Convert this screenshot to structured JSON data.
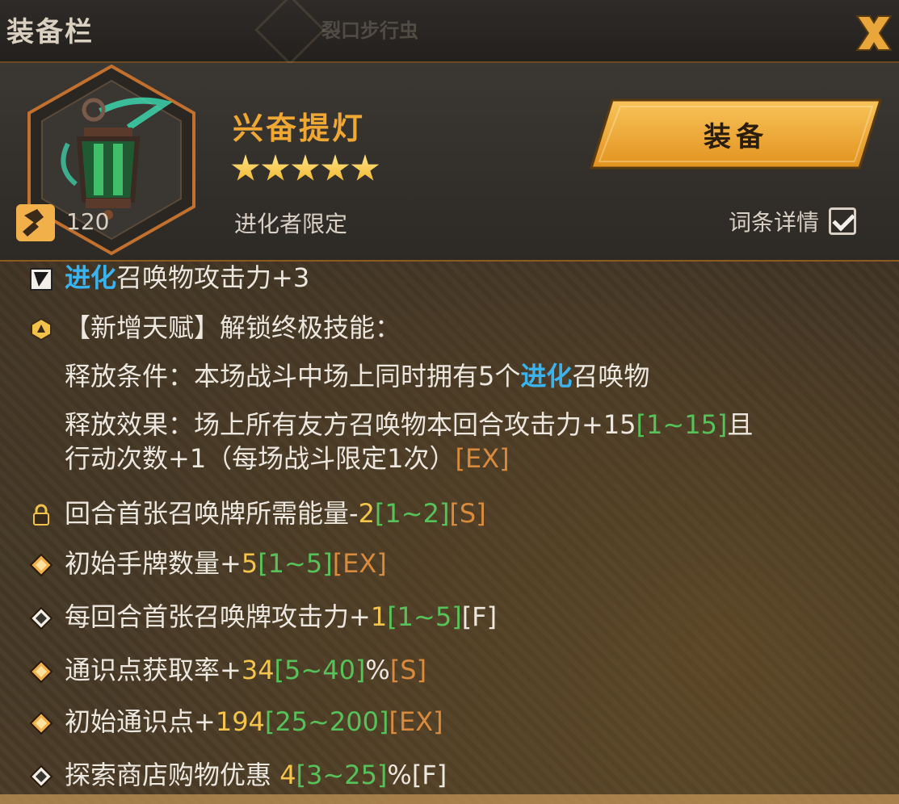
{
  "window": {
    "title": "装备栏",
    "background_label": "裂口步行虫"
  },
  "item": {
    "name": "兴奋提灯",
    "stars": 5,
    "restriction": "进化者限定",
    "level": "120",
    "icon": "green-lantern-icon"
  },
  "actions": {
    "equip_label": "装备",
    "detail_label": "词条详情",
    "detail_checked": true
  },
  "stats": [
    {
      "icon": "evolve-tag-icon",
      "parts": [
        {
          "t": "进化",
          "c": "blue"
        },
        {
          "t": "召唤物攻击力+3",
          "c": "white"
        }
      ]
    },
    {
      "icon": "talent-hexagon-icon",
      "parts": [
        {
          "t": "【新增天赋】解锁终极技能：",
          "c": "white"
        }
      ]
    },
    {
      "icon": "",
      "parts": [
        {
          "t": "释放条件：本场战斗中场上同时拥有5个",
          "c": "white"
        },
        {
          "t": "进化",
          "c": "blue"
        },
        {
          "t": "召唤物",
          "c": "white"
        }
      ]
    },
    {
      "icon": "",
      "parts": [
        {
          "t": "释放效果：场上所有友方召唤物本回合攻击力+15",
          "c": "white"
        },
        {
          "t": "[1~15]",
          "c": "green"
        },
        {
          "t": "且",
          "c": "white"
        }
      ]
    },
    {
      "icon": "",
      "parts": [
        {
          "t": "行动次数+1（每场战斗限定1次）",
          "c": "white"
        },
        {
          "t": "[EX]",
          "c": "orange"
        }
      ]
    },
    {
      "icon": "lock-icon",
      "parts": [
        {
          "t": "回合首张召唤牌所需能量-",
          "c": "white"
        },
        {
          "t": "2",
          "c": "yellow"
        },
        {
          "t": "[1~2]",
          "c": "green"
        },
        {
          "t": "[S]",
          "c": "orange"
        }
      ]
    },
    {
      "icon": "diamond-gold-icon",
      "parts": [
        {
          "t": "初始手牌数量+",
          "c": "white"
        },
        {
          "t": "5",
          "c": "yellow"
        },
        {
          "t": "[1~5]",
          "c": "green"
        },
        {
          "t": "[EX]",
          "c": "orange"
        }
      ]
    },
    {
      "icon": "diamond-white-icon",
      "parts": [
        {
          "t": "每回合首张召唤牌攻击力+",
          "c": "white"
        },
        {
          "t": "1",
          "c": "yellow"
        },
        {
          "t": "[1~5]",
          "c": "green"
        },
        {
          "t": "[F]",
          "c": "white"
        }
      ]
    },
    {
      "icon": "diamond-gold-icon",
      "parts": [
        {
          "t": "通识点获取率+",
          "c": "white"
        },
        {
          "t": "34",
          "c": "yellow"
        },
        {
          "t": "[5~40]",
          "c": "green"
        },
        {
          "t": "%",
          "c": "white"
        },
        {
          "t": "[S]",
          "c": "orange"
        }
      ]
    },
    {
      "icon": "diamond-gold-icon",
      "parts": [
        {
          "t": "初始通识点+",
          "c": "white"
        },
        {
          "t": "194",
          "c": "yellow"
        },
        {
          "t": "[25~200]",
          "c": "green"
        },
        {
          "t": "[EX]",
          "c": "orange"
        }
      ]
    },
    {
      "icon": "diamond-white-icon",
      "parts": [
        {
          "t": "探索商店购物优惠 ",
          "c": "white"
        },
        {
          "t": "4",
          "c": "yellow"
        },
        {
          "t": "[3~25]",
          "c": "green"
        },
        {
          "t": "%[F]",
          "c": "white"
        }
      ]
    }
  ],
  "colors": {
    "accent_orange": "#f0a835",
    "evolve_blue": "#3ab4f0",
    "value_yellow": "#f4c54a",
    "range_green": "#58c25a",
    "rank_orange": "#d98a3c"
  }
}
